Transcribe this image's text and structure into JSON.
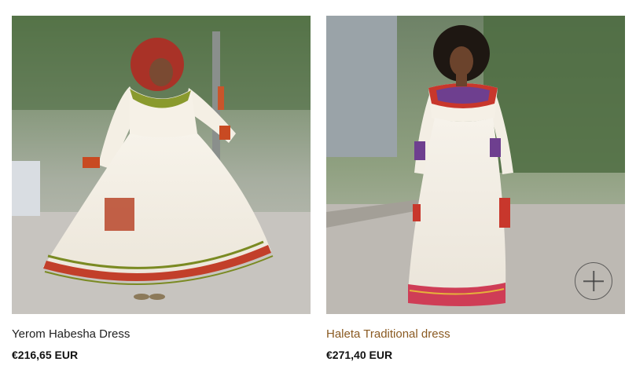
{
  "products": [
    {
      "title": "Yerom Habesha Dress",
      "price": "€216,65 EUR",
      "image_alt": "Yerom Habesha Dress"
    },
    {
      "title": "Haleta Traditional dress",
      "price": "€271,40 EUR",
      "image_alt": "Haleta Traditional dress",
      "quick_add_icon": "plus-icon"
    }
  ],
  "colors": {
    "title_default": "#222222",
    "title_hover": "#8a5a22",
    "price": "#111111"
  }
}
